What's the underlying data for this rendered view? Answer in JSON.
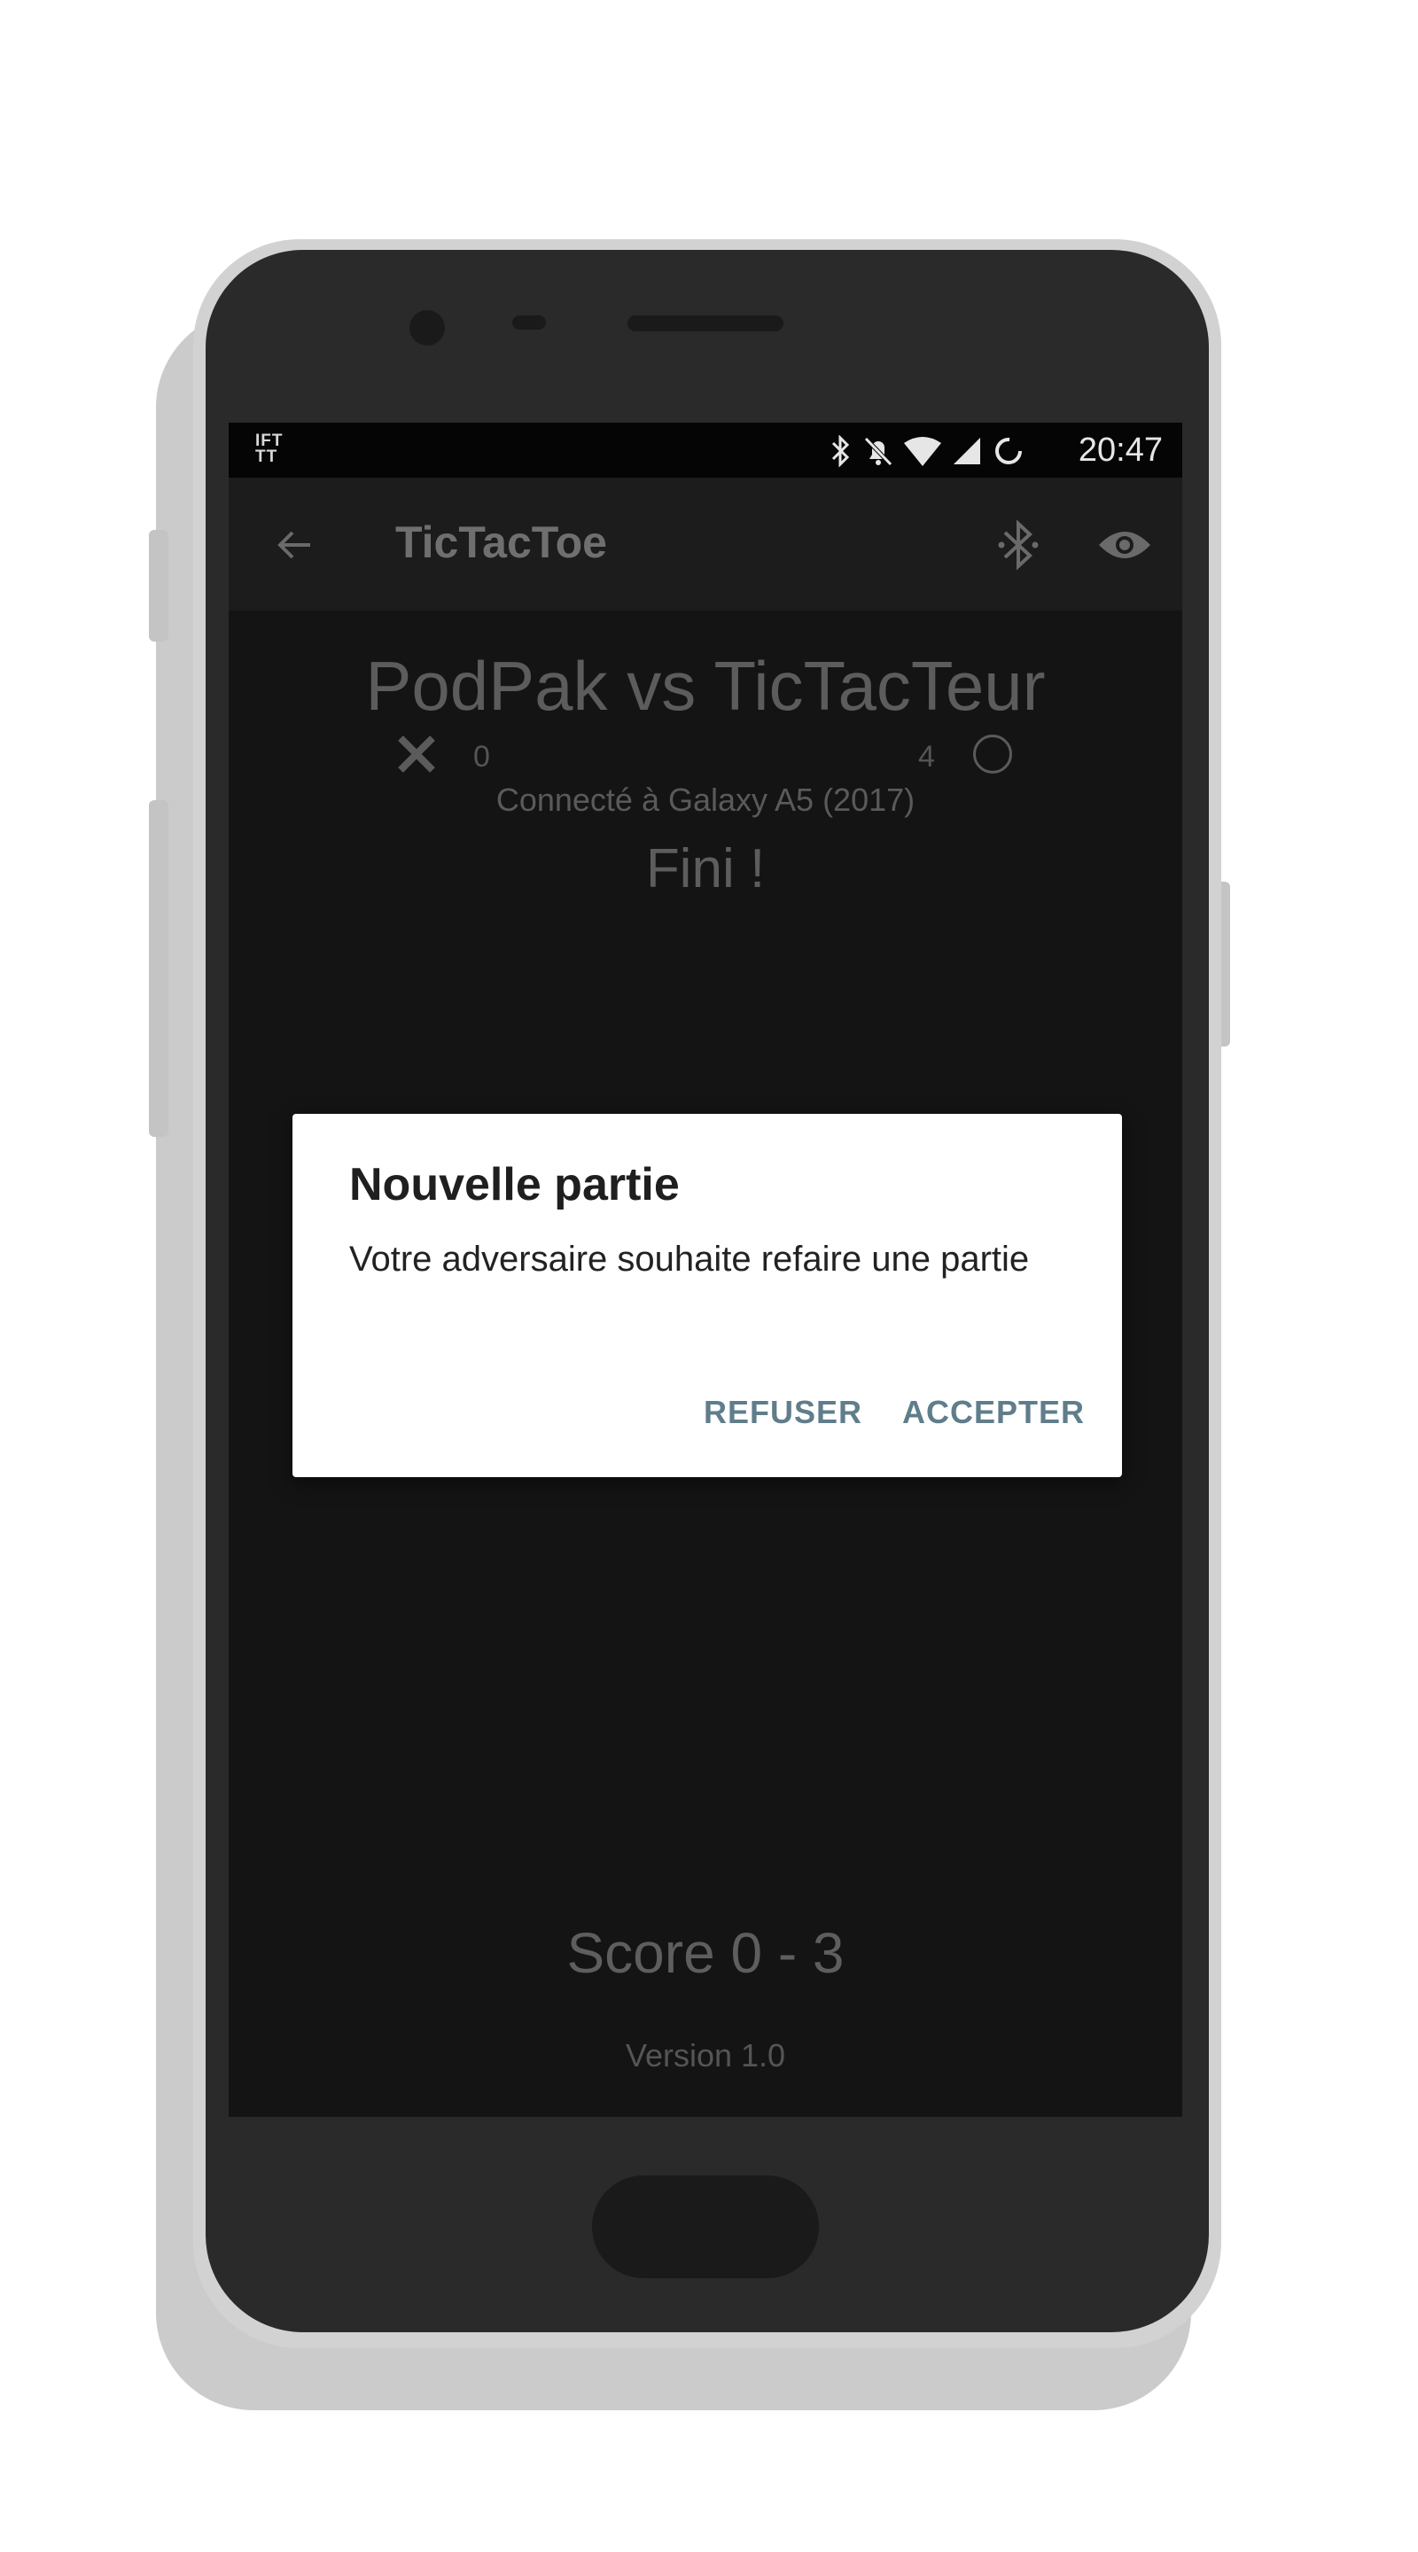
{
  "status_bar": {
    "app_badge": "IFT TT",
    "time": "20:47",
    "icons": [
      "bluetooth-icon",
      "notifications-off-icon",
      "wifi-icon",
      "signal-icon",
      "sync-icon"
    ]
  },
  "toolbar": {
    "title": "TicTacToe",
    "icons": [
      "back-arrow-icon",
      "bluetooth-searching-icon",
      "eye-icon"
    ]
  },
  "game": {
    "match_title": "PodPak vs TicTacTeur",
    "player_x_score": "0",
    "player_o_score": "4",
    "connected_to": "Connecté à Galaxy A5 (2017)",
    "status": "Fini !",
    "score_summary": "Score 0 - 3",
    "version": "Version 1.0"
  },
  "dialog": {
    "title": "Nouvelle partie",
    "message": "Votre adversaire souhaite refaire une partie",
    "refuse_label": "REFUSER",
    "accept_label": "ACCEPTER",
    "button_color": "#607d8b"
  }
}
